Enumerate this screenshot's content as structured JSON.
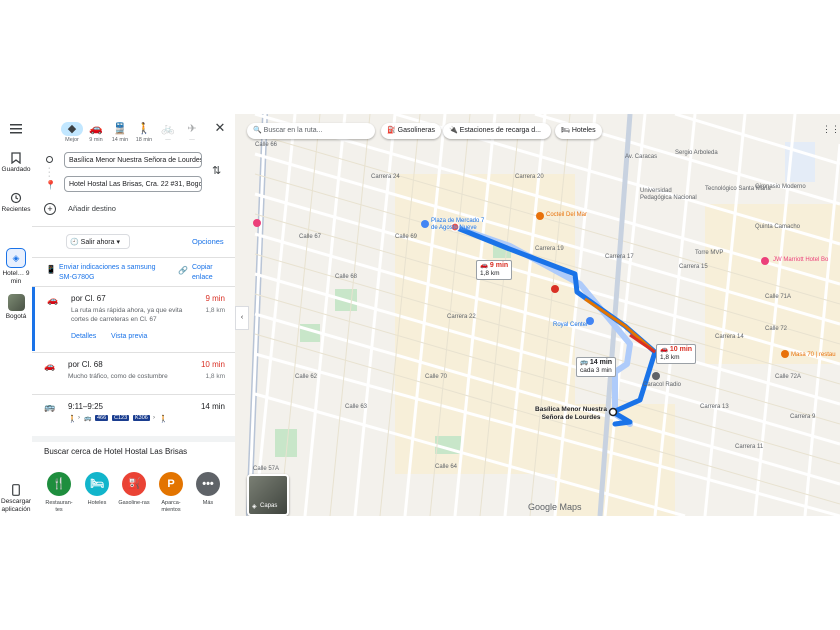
{
  "rail": {
    "saved": "Guardado",
    "recent": "Recientes",
    "active_trip": "Hotel… 9 min",
    "bogota": "Bogotá",
    "download": "Descargar aplicación"
  },
  "modes": [
    {
      "label": "Mejor",
      "icon": "◆"
    },
    {
      "label": "9 min",
      "icon": "🚗"
    },
    {
      "label": "14 min",
      "icon": "🚆"
    },
    {
      "label": "18 min",
      "icon": "🚶"
    },
    {
      "label": "—",
      "icon": "🚲"
    },
    {
      "label": "—",
      "icon": "✈"
    }
  ],
  "directions": {
    "origin": "Basílica Menor Nuestra Señora de Lourdes",
    "destination": "Hotel Hostal Las Brisas, Cra. 22 #31, Bogotá",
    "add_destination": "Añadir destino",
    "depart": "Salir ahora",
    "options": "Opciones",
    "send_to_phone": "Enviar indicaciones a samsung SM-G780G",
    "copy_link": "Copiar enlace"
  },
  "routes": [
    {
      "title": "por Cl. 67",
      "time": "9 min",
      "dist": "1,8 km",
      "desc": "La ruta más rápida ahora, ya que evita cortes de carreteras en Cl. 67",
      "details": "Detalles",
      "preview": "Vista previa"
    },
    {
      "title": "por Cl. 68",
      "time": "10 min",
      "dist": "1,8 km",
      "desc": "Mucho tráfico, como de costumbre"
    },
    {
      "title": "9:11–9:25",
      "time": "14 min",
      "buses": [
        "466",
        "C123",
        "K306"
      ]
    }
  ],
  "nearby": {
    "title": "Buscar cerca de Hotel Hostal Las Brisas",
    "items": [
      {
        "label": "Restauran-tes",
        "color": "#1e8e3e",
        "icon": "🍴"
      },
      {
        "label": "Hoteles",
        "color": "#12b5cb",
        "icon": "🛏"
      },
      {
        "label": "Gasoline-ras",
        "color": "#ea4335",
        "icon": "⛽"
      },
      {
        "label": "Aparca-mientos",
        "color": "#e37400",
        "icon": "P"
      },
      {
        "label": "Más",
        "color": "#5f6368",
        "icon": "•••"
      }
    ]
  },
  "map": {
    "search_placeholder": "Buscar en la ruta...",
    "chips": [
      "Gasolineras",
      "Estaciones de recarga d...",
      "Hoteles"
    ],
    "badge1": {
      "time": "9 min",
      "dist": "1,8 km"
    },
    "badge2": {
      "time": "10 min",
      "dist": "1,8 km"
    },
    "badge3": {
      "time": "14 min",
      "dist": "cada 3 min"
    },
    "poi_start": "Basílica Menor Nuestra Señora de Lourdes",
    "poi_dest": "Plaza de Mercado 7 de Agosto Nueve",
    "layers": "Capas",
    "watermark": "Google Maps",
    "labels": [
      "Calle 66",
      "Calle 67",
      "Calle 68",
      "Calle 69",
      "Calle 70",
      "Calle 72",
      "Calle 62",
      "Calle 63",
      "Calle 64",
      "Calle 57A",
      "Carrera 24",
      "Carrera 22",
      "Carrera 20",
      "Carrera 19",
      "Carrera 17",
      "Carrera 15",
      "Carrera 14",
      "Carrera 13",
      "Carrera 11",
      "Carrera 9",
      "Av. Caracas",
      "Royal Center",
      "Caracol Radio",
      "Cocteil Del Mar",
      "JW Marriott Hotel Bo",
      "Tecnológico Santa Maria",
      "Universidad Pedagógica Nacional",
      "Gimnasio Moderno",
      "Torre MVP",
      "Masa 70 | restau",
      "Sergio Arboleda",
      "Quinta Camacho",
      "Calle 71A",
      "Calle 72A"
    ]
  },
  "colors": {
    "route": "#1a73e8",
    "traffic": "#e37400",
    "accent": "#1a73e8",
    "selected_mode": "#c2e7ff"
  }
}
